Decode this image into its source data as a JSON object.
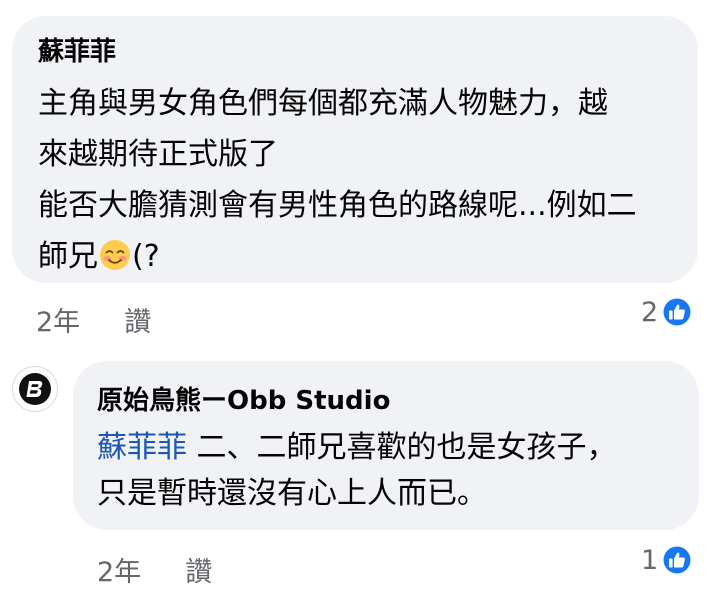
{
  "comment": {
    "author": "蘇菲菲",
    "lines": [
      "主角與男女角色們每個都充滿人物魅力，越",
      "來越期待正式版了",
      "能否大膽猜測會有男性角色的路線呢...例如二"
    ],
    "last_line_before_emoji": "師兄",
    "last_line_after_emoji": "(?",
    "emoji": "smiling-face-with-blush",
    "time": "2年",
    "like_label": "讚",
    "reaction_count": "2"
  },
  "reply": {
    "author": "原始鳥熊ーObb Studio",
    "mention": "蘇菲菲",
    "line1_rest": " 二、二師兄喜歡的也是女孩子，",
    "line2": "只是暫時還沒有心上人而已。",
    "time": "2年",
    "like_label": "讚",
    "reaction_count": "1",
    "avatar_icon": "obb-studio-logo-icon"
  },
  "colors": {
    "bubble_bg": "#f0f2f5",
    "mention": "#1b56b8",
    "meta_text": "#65676b",
    "like_blue": "#1877f2"
  }
}
